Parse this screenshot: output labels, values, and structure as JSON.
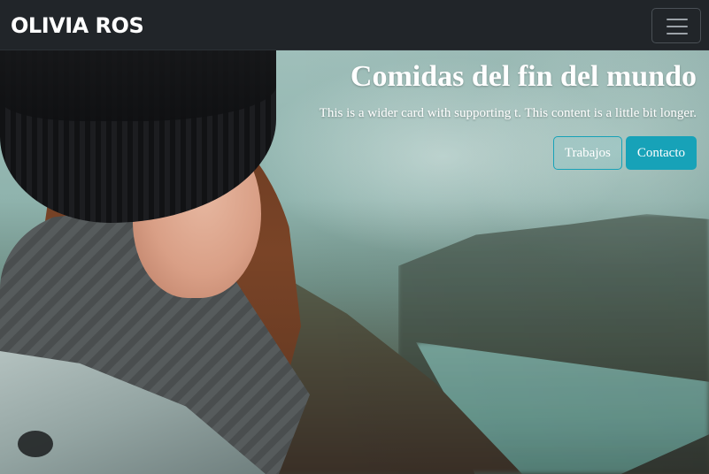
{
  "navbar": {
    "brand": "OLIVIA ROS",
    "toggler_icon": "hamburger-menu-icon"
  },
  "hero": {
    "title": "Comidas del fin del mundo",
    "text": "This is a wider card with supporting t. This content is a little bit longer.",
    "buttons": {
      "trabajos": "Trabajos",
      "contacto": "Contacto"
    }
  },
  "colors": {
    "navbar_bg": "#212529",
    "accent": "#17a2b8",
    "text": "#ffffff"
  }
}
